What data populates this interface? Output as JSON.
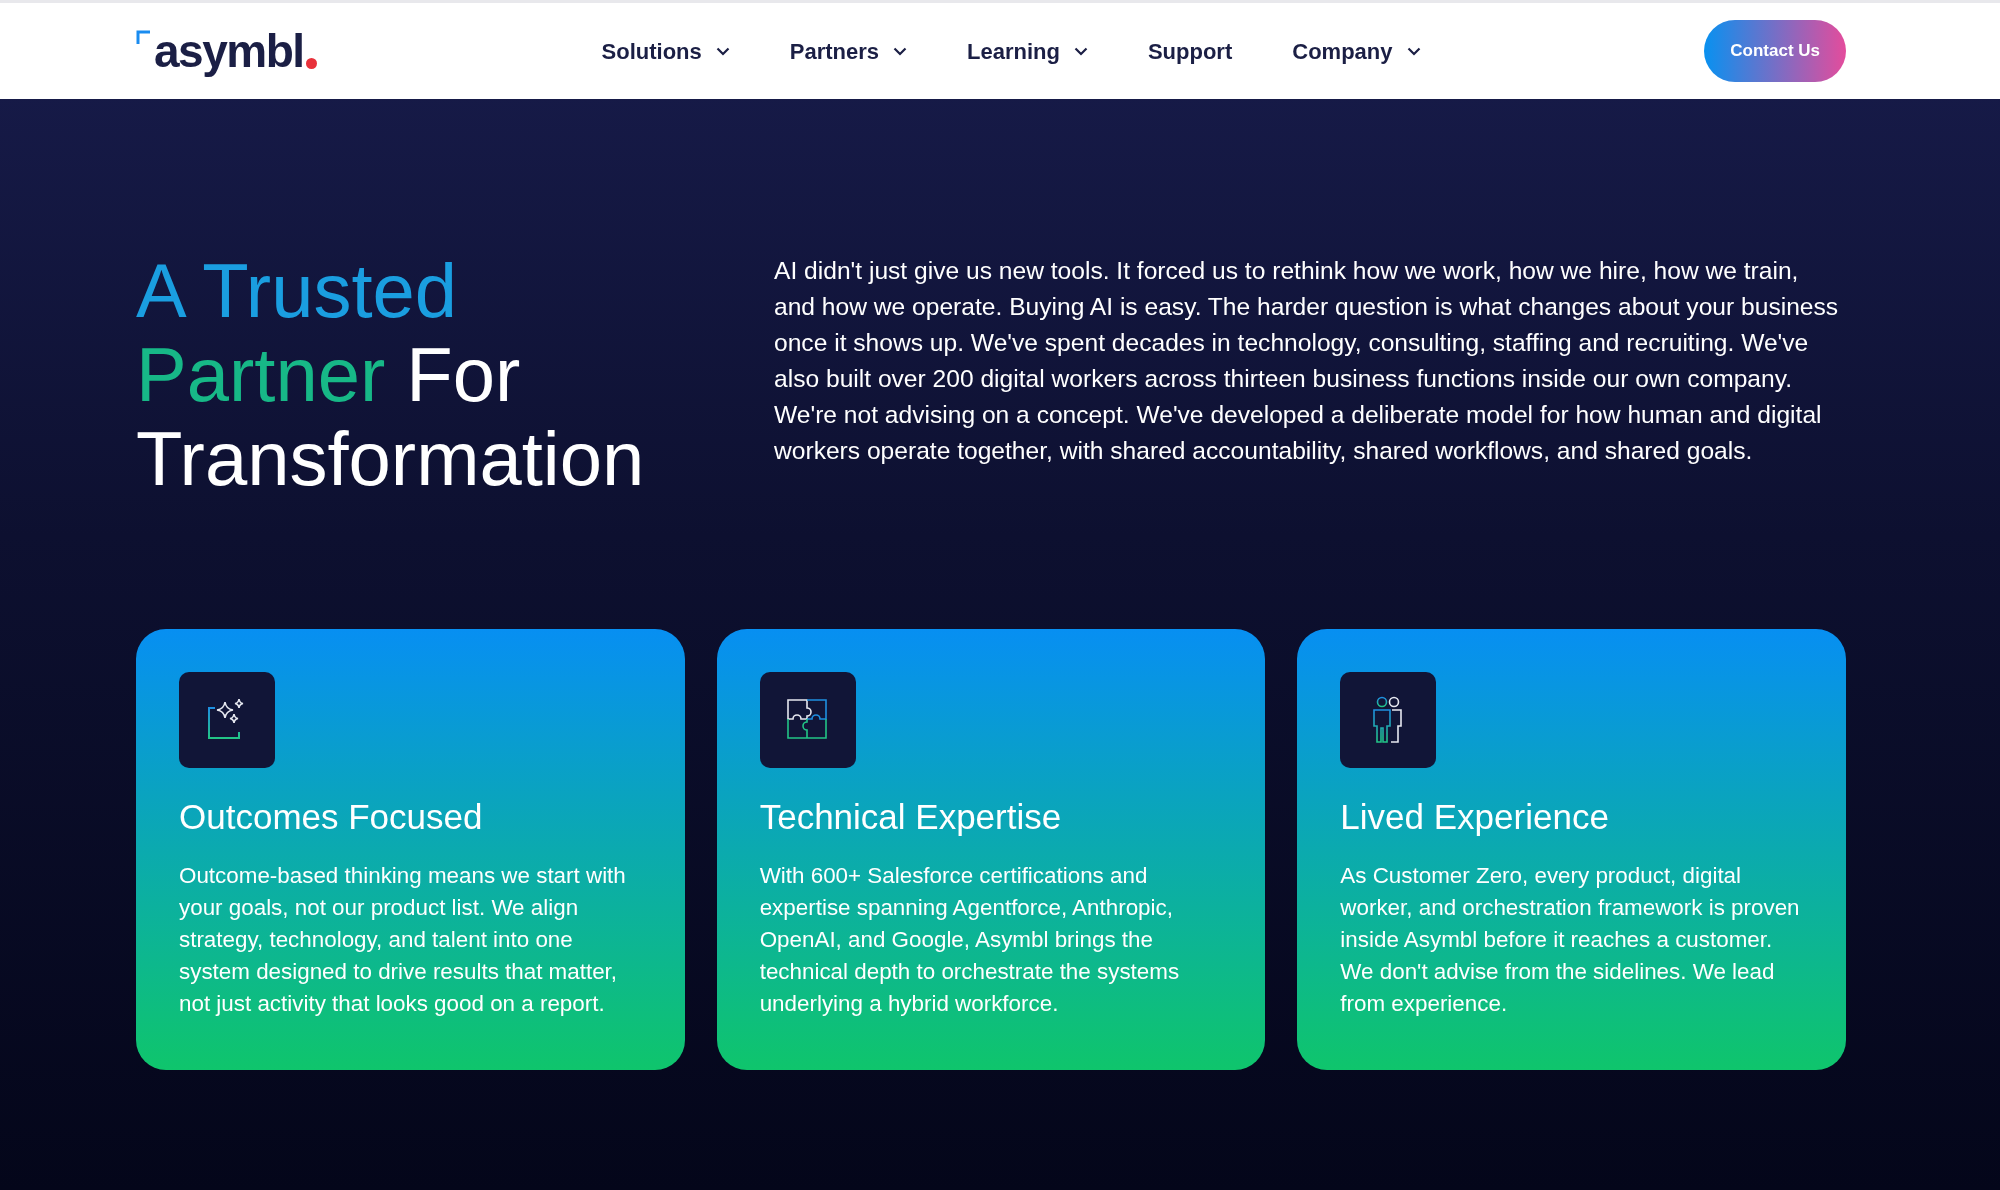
{
  "header": {
    "logo": "asymbl",
    "nav": [
      {
        "label": "Solutions",
        "dropdown": true
      },
      {
        "label": "Partners",
        "dropdown": true
      },
      {
        "label": "Learning",
        "dropdown": true
      },
      {
        "label": "Support",
        "dropdown": false
      },
      {
        "label": "Company",
        "dropdown": true
      }
    ],
    "cta": "Contact Us"
  },
  "hero": {
    "heading": [
      [
        {
          "text": "A Trusted",
          "color": "#1a9ee0"
        }
      ],
      [
        {
          "text": "Partner",
          "color": "#17b887"
        },
        {
          "text": "For",
          "color": "#ffffff"
        }
      ],
      [
        {
          "text": "Transformation",
          "color": "#ffffff"
        }
      ]
    ],
    "intro": "AI didn't just give us new tools. It forced us to rethink how we work, how we hire, how we train, and how we operate. Buying AI is easy. The harder question is what changes about your business once it shows up. We've spent decades in technology, consulting, staffing and recruiting. We've also built over 200 digital workers across thirteen business functions inside our own company.  We're not advising on a concept. We've developed a deliberate model for how human and digital workers operate together, with shared accountability, shared workflows, and shared goals."
  },
  "cards": [
    {
      "kind": "sparkles",
      "title": "Outcomes Focused",
      "text": "Outcome-based thinking means we start with your goals, not our product list. We align strategy, technology, and talent into one system designed to drive results that matter, not just activity that looks good on a report."
    },
    {
      "kind": "puzzle",
      "title": "Technical Expertise",
      "text": "With 600+ Salesforce certifications and expertise spanning Agentforce, Anthropic, OpenAI, and Google, Asymbl brings the technical depth to orchestrate the systems underlying a hybrid workforce."
    },
    {
      "kind": "people",
      "title": "Lived Experience",
      "text": "As Customer Zero, every product, digital worker, and orchestration framework is proven inside Asymbl before it reaches a customer. We don't advise from the sidelines. We lead from experience."
    }
  ]
}
